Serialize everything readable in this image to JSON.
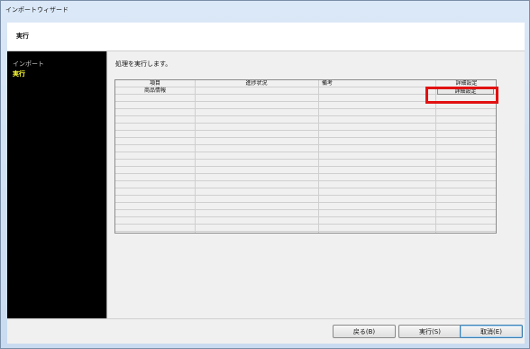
{
  "window": {
    "title": "インポートウィザード"
  },
  "header": {
    "title": "実行"
  },
  "sidebar": {
    "items": [
      {
        "label": "インポート"
      },
      {
        "label": "実行"
      }
    ]
  },
  "main": {
    "message": "処理を実行します。",
    "table": {
      "columns": [
        "項目",
        "進捗状況",
        "備考",
        "詳細設定"
      ],
      "rows": [
        {
          "item": "商品情報",
          "progress": "",
          "note": "",
          "detail_button": "詳細設定"
        }
      ]
    }
  },
  "footer": {
    "back_label": "戻る(B)",
    "run_label": "実行(S)",
    "cancel_label": "取消(E)"
  },
  "colors": {
    "highlight": "#e11111",
    "sidebar_bg": "#000000",
    "active_item": "#ffff33"
  }
}
